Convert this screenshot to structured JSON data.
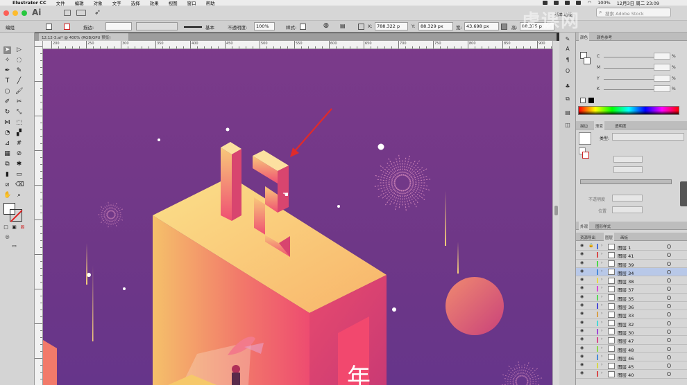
{
  "menubar": {
    "app_name": "Illustrator CC",
    "items": [
      "文件",
      "编辑",
      "对象",
      "文字",
      "选择",
      "效果",
      "视图",
      "窗口",
      "帮助"
    ],
    "battery": "100%",
    "datetime": "12月3日 周二 23:09"
  },
  "appbar": {
    "logo": "Ai",
    "workspace": "基本功能",
    "search_placeholder": "搜索 Adobe Stock"
  },
  "control": {
    "mode_label": "编组",
    "stroke_label": "描边:",
    "stroke_style": "基本",
    "opacity_label": "不透明度:",
    "opacity_value": "100%",
    "style_label": "样式:",
    "x_label": "X:",
    "x_value": "788.322 p",
    "y_label": "Y:",
    "y_value": "88.329 px",
    "w_label": "宽:",
    "w_value": "43.698 px",
    "h_label": "高:",
    "h_value": "88.375 p"
  },
  "document": {
    "tab_label": "12.12-3.ai* @ 400% (RGB/GPU 预览)"
  },
  "ruler": {
    "h_ticks": [
      "200",
      "250",
      "300",
      "350",
      "400",
      "450",
      "500",
      "550",
      "600",
      "650",
      "700",
      "750",
      "800",
      "850",
      "900"
    ]
  },
  "color_panel": {
    "tabs": [
      "颜色",
      "颜色参考"
    ],
    "channels": [
      {
        "name": "C",
        "unit": "%"
      },
      {
        "name": "M",
        "unit": "%"
      },
      {
        "name": "Y",
        "unit": "%"
      },
      {
        "name": "K",
        "unit": "%"
      }
    ]
  },
  "stroke_panel": {
    "tabs": [
      "描边",
      "渐变",
      "透明度"
    ],
    "type_label": "类型:",
    "opacity_label": "不透明度",
    "position_label": "位置"
  },
  "layers_panel": {
    "tabs": [
      "外观",
      "图形样式"
    ],
    "subtabs": [
      "资源导出",
      "图层",
      "画板"
    ],
    "layers": [
      {
        "name": "图层 1",
        "color": "#4a6fd8",
        "locked": true
      },
      {
        "name": "图层 41",
        "color": "#d84a4a"
      },
      {
        "name": "图层 39",
        "color": "#4ad84a"
      },
      {
        "name": "图层 34",
        "color": "#4a8ad8",
        "selected": true
      },
      {
        "name": "图层 38",
        "color": "#e8d84a"
      },
      {
        "name": "图层 37",
        "color": "#d84ad8"
      },
      {
        "name": "图层 35",
        "color": "#5ad85a"
      },
      {
        "name": "图层 36",
        "color": "#4a4ad8"
      },
      {
        "name": "图层 33",
        "color": "#d8a04a"
      },
      {
        "name": "图层 32",
        "color": "#4ad8d8"
      },
      {
        "name": "图层 30",
        "color": "#a04ad8"
      },
      {
        "name": "图层 47",
        "color": "#d84a8a"
      },
      {
        "name": "图层 48",
        "color": "#8ad84a"
      },
      {
        "name": "图层 46",
        "color": "#4a8ad8"
      },
      {
        "name": "图层 45",
        "color": "#d8d84a"
      },
      {
        "name": "图层 40",
        "color": "#d84a4a"
      }
    ]
  },
  "artwork": {
    "colors": {
      "bg": "#7b3a8a",
      "accent": "#f0506e",
      "gold": "#f6c86a"
    },
    "text_partial": "年"
  },
  "watermark": "虎课网"
}
